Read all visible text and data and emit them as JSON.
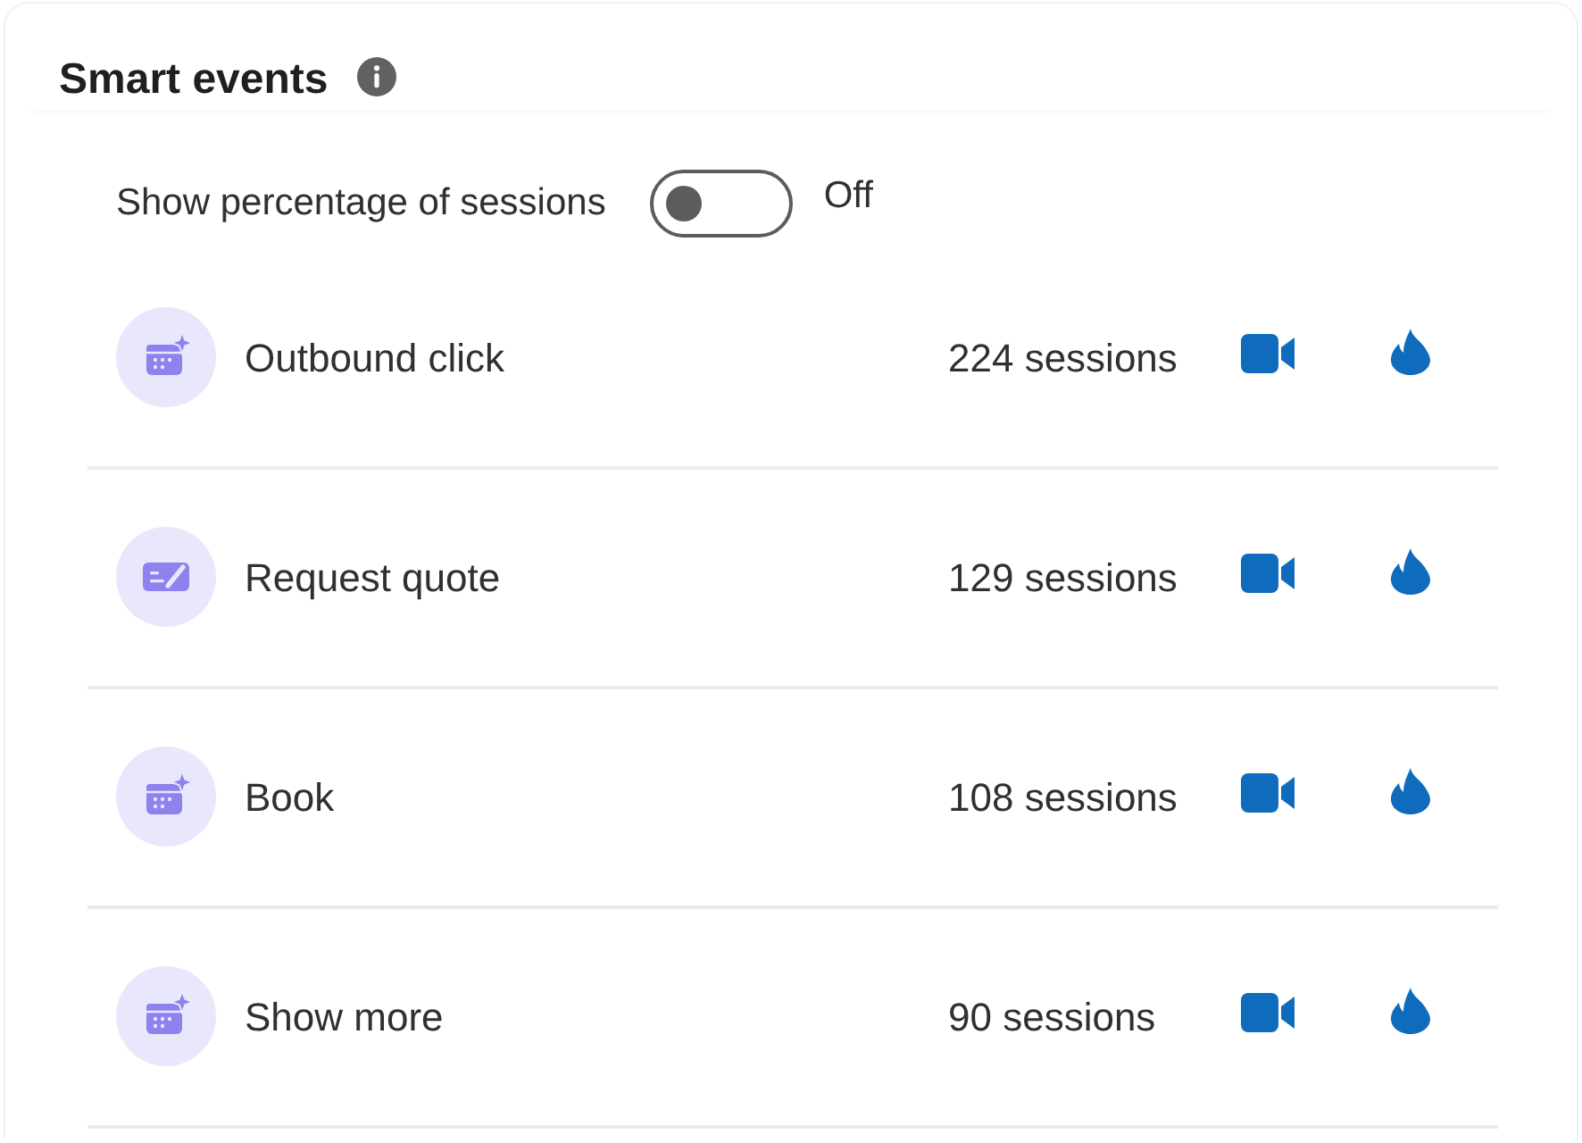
{
  "header": {
    "title": "Smart events"
  },
  "toggle": {
    "label": "Show percentage of sessions",
    "on": false,
    "state_text": "Off"
  },
  "events": [
    {
      "kind": "calendar",
      "name": "Outbound click",
      "sessions": "224 sessions"
    },
    {
      "kind": "form",
      "name": "Request quote",
      "sessions": "129 sessions"
    },
    {
      "kind": "calendar",
      "name": "Book",
      "sessions": "108 sessions"
    },
    {
      "kind": "calendar",
      "name": "Show more",
      "sessions": "90 sessions"
    }
  ]
}
